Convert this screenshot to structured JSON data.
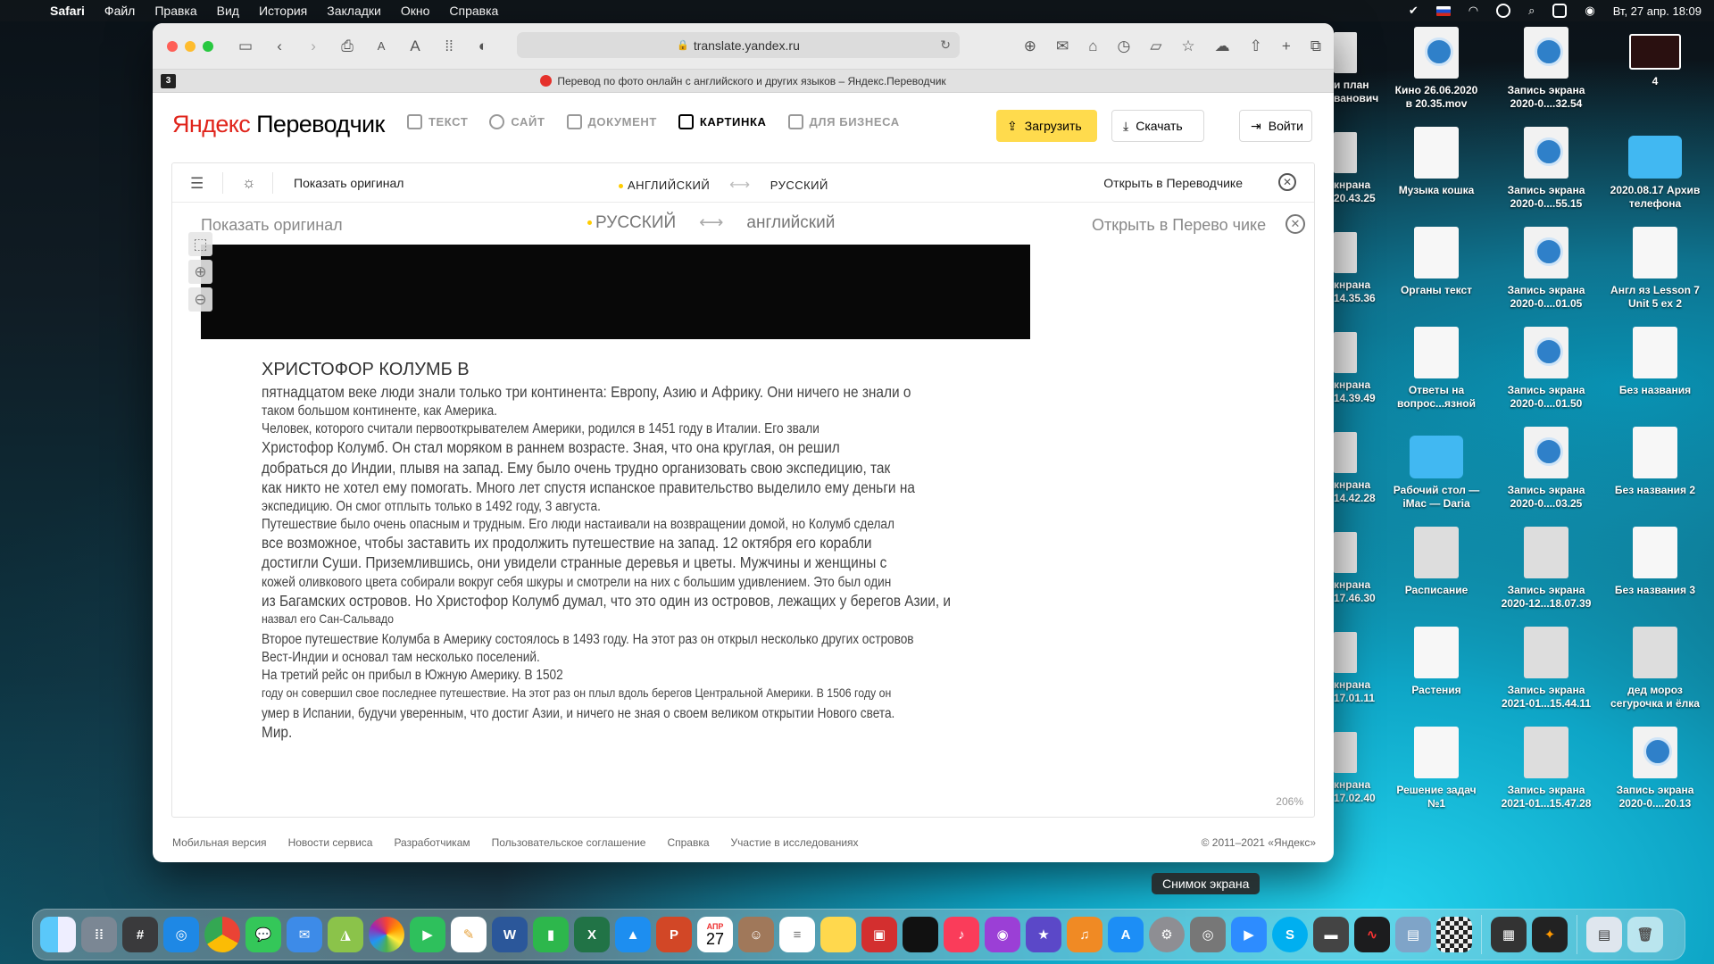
{
  "menubar": {
    "app_name": "Safari",
    "items": [
      "Файл",
      "Правка",
      "Вид",
      "История",
      "Закладки",
      "Окно",
      "Справка"
    ],
    "datetime": "Вт, 27 апр.  18:09"
  },
  "browser": {
    "url": "translate.yandex.ru",
    "tab_title": "Перевод по фото онлайн с английского и других языков – Яндекс.Переводчик",
    "badge": "3"
  },
  "site": {
    "logo_ya": "Яндекс",
    "logo_rest": " Переводчик",
    "nav": [
      "ТЕКСТ",
      "САЙТ",
      "ДОКУМЕНТ",
      "КАРТИНКА",
      "ДЛЯ БИЗНЕСА"
    ],
    "upload_label": "Загрузить",
    "download_label": "Скачать",
    "login_label": "Войти"
  },
  "panel": {
    "show_original": "Показать оригинал",
    "source_lang": "АНГЛИЙСКИЙ",
    "target_lang": "РУССКИЙ",
    "open_in_translator": "Открыть в Переводчике",
    "zoom": "206%"
  },
  "photo": {
    "ghost_show_original": "Показать оригинал",
    "ghost_source_lang": "РУССКИЙ",
    "ghost_target_lang": "английский",
    "ghost_open": "Открыть в Перево     чике",
    "lines": [
      "ХРИСТОФОР КОЛУМБ В",
      "пятнадцатом веке люди знали только три континента: Европу, Азию и Африку. Они ничего не знали о",
      "таком большом континенте, как Америка.",
      "Человек, которого считали первооткрывателем Америки, родился в 1451 году в Италии. Его звали",
      "Христофор Колумб. Он стал моряком в раннем возрасте. Зная, что она круглая, он решил",
      "добраться до Индии, плывя на запад. Ему было очень трудно организовать свою экспедицию, так",
      "как никто не хотел ему помогать. Много лет спустя испанское правительство выделило ему деньги на",
      "экспедицию. Он смог отплыть только в 1492 году, 3 августа.",
      "Путешествие было очень опасным и трудным. Его люди настаивали на возвращении домой, но Колумб сделал",
      "все возможное, чтобы заставить их продолжить путешествие на запад. 12 октября его корабли",
      "достигли Суши. Приземлившись, они увидели странные деревья и цветы. Мужчины и женщины с",
      "кожей оливкового цвета собирали вокруг себя шкуры и смотрели на них с большим удивлением. Это был один",
      "из Багамских островов. Но Христофор Колумб думал, что это один из островов, лежащих у берегов Азии, и",
      "назвал его Сан-Сальвадо",
      "Второе путешествие Колумба в Америку состоялось в 1493 году. На этот раз он открыл несколько других островов",
      "Вест-Индии и основал там несколько поселений.",
      "На третий рейс он прибыл в Южную Америку. В 1502",
      "году он совершил свое последнее путешествие. На этот раз он плыл вдоль берегов Центральной Америки. В 1506 году он",
      "умер в Испании, будучи уверенным, что достиг Азии, и ничего не зная о своем великом открытии Нового света.",
      "Мир."
    ]
  },
  "footer": {
    "links": [
      "Мобильная версия",
      "Новости сервиса",
      "Разработчикам",
      "Пользовательское соглашение",
      "Справка",
      "Участие в исследованиях"
    ],
    "copyright": "© 2011–2021 «Яндекс»"
  },
  "desktop": {
    "partial": [
      "и план\nванович",
      "кнрана\n20.43.25",
      "кнрана\n14.35.36",
      "кнрана\n14.39.49",
      "кнрана\n14.42.28",
      "кнрана\n17.46.30",
      "кнрана\n17.01.11",
      "кнрана\n17.02.40"
    ],
    "col1": [
      "Кино 26.06.2020\nв 20.35.mov",
      "Музыка кошка",
      "Органы текст",
      "Ответы на\nвопрос...язной",
      "Рабочий стол —\niMac — Daria",
      "Расписание",
      "Растения",
      "Решение задач\n№1"
    ],
    "col2": [
      "Запись экрана\n2020-0....32.54",
      "Запись экрана\n2020-0....55.15",
      "Запись экрана\n2020-0....01.05",
      "Запись экрана\n2020-0....01.50",
      "Запись экрана\n2020-0....03.25",
      "Запись экрана\n2020-12...18.07.39",
      "Запись экрана\n2021-01...15.44.11",
      "Запись экрана\n2021-01...15.47.28"
    ],
    "col3": [
      "4",
      "2020.08.17 Архив\nтелефона",
      "Англ яз Lesson 7\nUnit 5 ex 2",
      "Без названия",
      "Без названия 2",
      "Без названия 3",
      "дед мороз\nсегурочка и ёлка",
      "Запись экрана\n2020-0....20.13"
    ]
  },
  "dock": {
    "tooltip": "Снимок экрана",
    "calendar_month": "АПР",
    "calendar_day": "27"
  }
}
